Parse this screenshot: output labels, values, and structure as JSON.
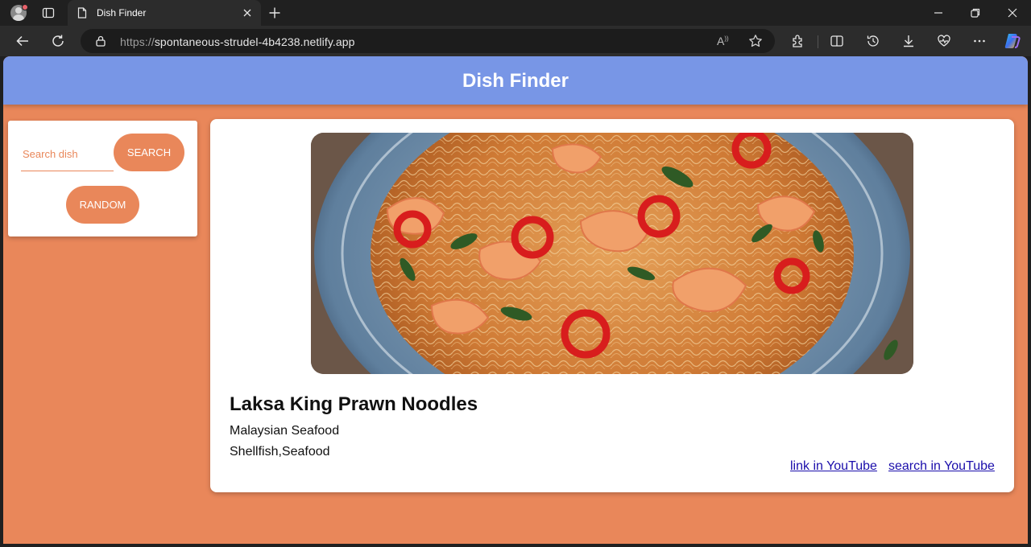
{
  "browser": {
    "tab_title": "Dish Finder",
    "url_protocol": "https://",
    "url_host": "spontaneous-strudel-4b4238.netlify.app"
  },
  "app": {
    "title": "Dish Finder"
  },
  "search": {
    "placeholder": "Search dish",
    "search_label": "SEARCH",
    "random_label": "RANDOM"
  },
  "meal": {
    "name": "Laksa King Prawn Noodles",
    "area_category": "Malaysian Seafood",
    "tags": "Shellfish,Seafood",
    "link_youtube": "link in YouTube",
    "search_youtube": "search in YouTube"
  },
  "colors": {
    "accent": "#e9875a",
    "header": "#7896e6",
    "link": "#1a0dab"
  }
}
